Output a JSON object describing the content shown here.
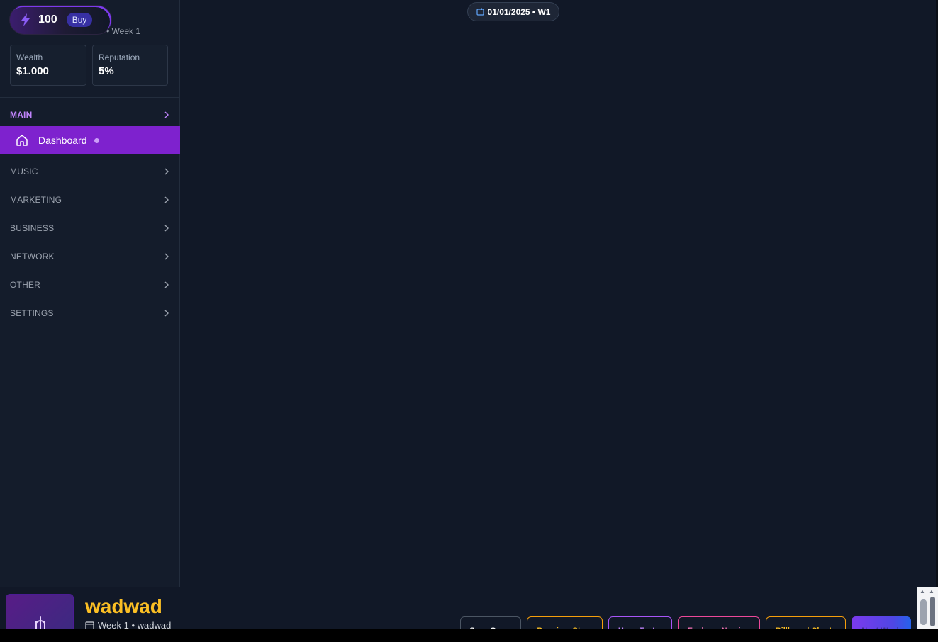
{
  "header": {
    "energy": "100",
    "buy_label": "Buy",
    "sub_line": "• Week 1",
    "stats": [
      {
        "label": "Wealth",
        "value": "$1.000"
      },
      {
        "label": "Reputation",
        "value": "5%"
      }
    ]
  },
  "nav": {
    "sections": [
      "MAIN",
      "MUSIC",
      "MARKETING",
      "BUSINESS",
      "NETWORK",
      "OTHER",
      "SETTINGS"
    ],
    "active_item": "Dashboard"
  },
  "date_chip": "01/01/2025 • W1",
  "artist": {
    "name": "wadwad",
    "subtitle": "Week 1 • wadwad"
  },
  "actions": {
    "save": "Save Game",
    "premium": "Premium Store",
    "hype": "Hype Tester",
    "fanbase": "Fanbase Naming",
    "billboard": "Billboard Charts",
    "next": "Next Week"
  },
  "colors": {
    "background": "#111827",
    "sidebar": "#141c2b",
    "accent": "#7e22ce",
    "artist_name": "#fbbf24"
  },
  "icons": {
    "energy": "bolt-icon",
    "dashboard": "home-icon",
    "section_chevron": "chevron-right-icon",
    "date": "calendar-icon",
    "album": "microphone-icon"
  }
}
